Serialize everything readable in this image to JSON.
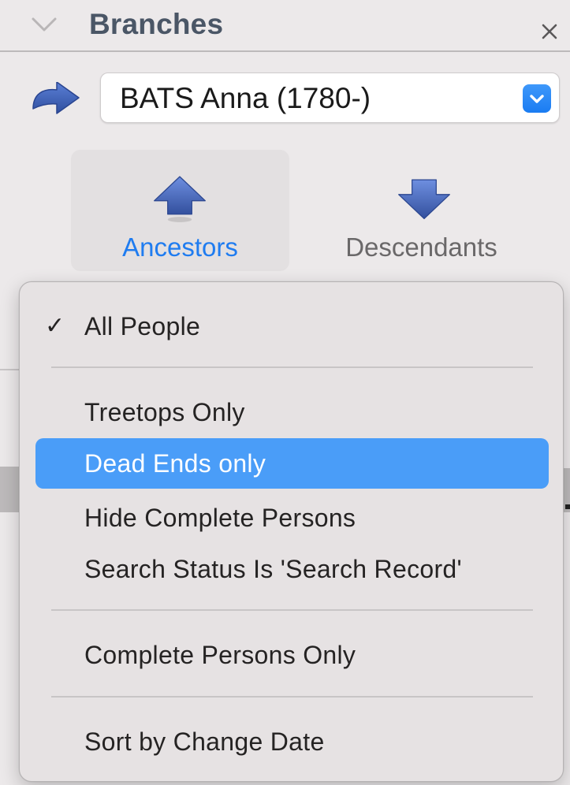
{
  "panel": {
    "title": "Branches",
    "close_label": "×"
  },
  "person_selector": {
    "value": "BATS Anna (1780-)"
  },
  "direction": {
    "ancestors_label": "Ancestors",
    "descendants_label": "Descendants",
    "selected": "Ancestors"
  },
  "filter_menu": {
    "check_mark": "✓",
    "items": [
      {
        "label": "All People",
        "checked": true,
        "highlighted": false
      },
      {
        "label": "Treetops Only",
        "checked": false,
        "highlighted": false
      },
      {
        "label": "Dead Ends only",
        "checked": false,
        "highlighted": true
      },
      {
        "label": "Hide Complete Persons",
        "checked": false,
        "highlighted": false
      },
      {
        "label": "Search Status Is 'Search Record'",
        "checked": false,
        "highlighted": false
      },
      {
        "label": "Complete Persons Only",
        "checked": false,
        "highlighted": false
      },
      {
        "label": "Sort by Change Date",
        "checked": false,
        "highlighted": false
      }
    ]
  },
  "colors": {
    "accent": "#1f7cf0",
    "highlight": "#4a9df8",
    "arrow_blue": "#3b5fb8"
  },
  "icons": {
    "go": "curved-arrow-icon",
    "ancestors": "up-arrow-icon",
    "descendants": "down-arrow-icon",
    "stepper": "chevron-down-icon",
    "collapse": "chevron-down-icon",
    "close": "close-icon"
  }
}
